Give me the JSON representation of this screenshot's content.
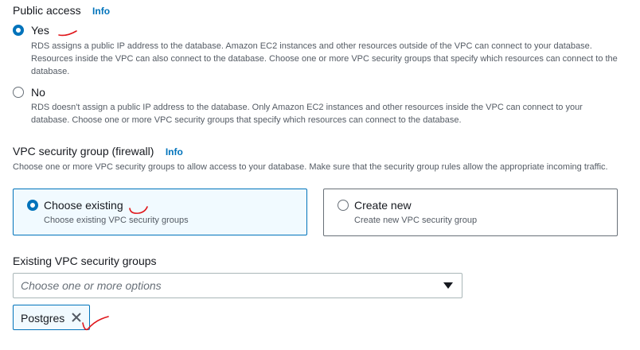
{
  "public_access": {
    "title": "Public access",
    "info": "Info",
    "options": [
      {
        "label": "Yes",
        "selected": true,
        "description": "RDS assigns a public IP address to the database. Amazon EC2 instances and other resources outside of the VPC can connect to your database. Resources inside the VPC can also connect to the database. Choose one or more VPC security groups that specify which resources can connect to the database."
      },
      {
        "label": "No",
        "selected": false,
        "description": "RDS doesn't assign a public IP address to the database. Only Amazon EC2 instances and other resources inside the VPC can connect to your database. Choose one or more VPC security groups that specify which resources can connect to the database."
      }
    ]
  },
  "vpc_security_group": {
    "title": "VPC security group (firewall)",
    "info": "Info",
    "description": "Choose one or more VPC security groups to allow access to your database. Make sure that the security group rules allow the appropriate incoming traffic.",
    "options": [
      {
        "label": "Choose existing",
        "description": "Choose existing VPC security groups",
        "selected": true
      },
      {
        "label": "Create new",
        "description": "Create new VPC security group",
        "selected": false
      }
    ]
  },
  "existing_groups": {
    "label": "Existing VPC security groups",
    "placeholder": "Choose one or more options",
    "tokens": [
      "Postgres"
    ]
  },
  "colors": {
    "accent": "#0073bb",
    "annotation": "#e0161b",
    "text": "#16191f",
    "secondary_text": "#545b64"
  }
}
